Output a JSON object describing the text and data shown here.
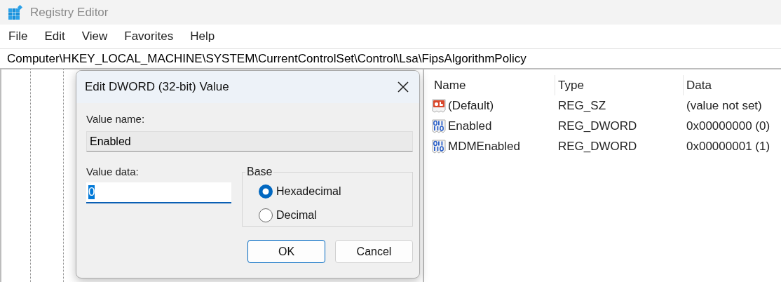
{
  "window": {
    "title": "Registry Editor"
  },
  "menu": [
    "File",
    "Edit",
    "View",
    "Favorites",
    "Help"
  ],
  "address": "Computer\\HKEY_LOCAL_MACHINE\\SYSTEM\\CurrentControlSet\\Control\\Lsa\\FipsAlgorithmPolicy",
  "values": {
    "columns": [
      "Name",
      "Type",
      "Data"
    ],
    "rows": [
      {
        "kind": "string",
        "name": "(Default)",
        "type": "REG_SZ",
        "data": "(value not set)"
      },
      {
        "kind": "binary",
        "name": "Enabled",
        "type": "REG_DWORD",
        "data": "0x00000000 (0)"
      },
      {
        "kind": "binary",
        "name": "MDMEnabled",
        "type": "REG_DWORD",
        "data": "0x00000001 (1)"
      }
    ]
  },
  "dialog": {
    "title": "Edit DWORD (32-bit) Value",
    "value_name_label": "Value name:",
    "value_name": "Enabled",
    "value_data_label": "Value data:",
    "value_data": "0",
    "value_data_selected": true,
    "base_label": "Base",
    "bases": [
      {
        "label": "Hexadecimal",
        "selected": true
      },
      {
        "label": "Decimal",
        "selected": false
      }
    ],
    "buttons": [
      {
        "label": "OK",
        "default": true
      },
      {
        "label": "Cancel",
        "default": false
      }
    ]
  }
}
